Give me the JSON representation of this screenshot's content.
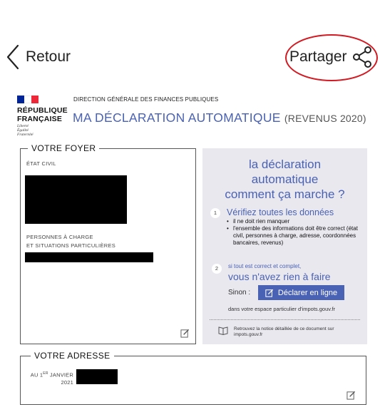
{
  "nav": {
    "back_label": "Retour",
    "share_label": "Partager"
  },
  "header": {
    "republic_line1": "RÉPUBLIQUE",
    "republic_line2": "FRANÇAISE",
    "motto": [
      "Liberté",
      "Égalité",
      "Fraternité"
    ],
    "dgfip": "DIRECTION GÉNÉRALE DES FINANCES PUBLIQUES",
    "title": "MA DÉCLARATION AUTOMATIQUE",
    "subtitle": "(REVENUS 2020)"
  },
  "foyer": {
    "legend": "VOTRE FOYER",
    "etat_civil_label": "ÉTAT CIVIL",
    "charge_label_line1": "PERSONNES À CHARGE",
    "charge_label_line2": "ET SITUATIONS PARTICULIÈRES"
  },
  "help": {
    "title_line1": "la déclaration",
    "title_line2": "automatique",
    "title_line3": "comment ça marche ?",
    "step1_num": "1",
    "step1_title": "Vérifiez toutes les données",
    "step1_bullets": [
      "il ne doit rien manquer",
      "l'ensemble des informations doit être correct (état civil, personnes à charge, adresse, coordonnées bancaires, revenus)"
    ],
    "step2_num": "2",
    "step2_line1": "si tout est correct et complet,",
    "step2_line2": "vous n'avez rien à faire",
    "sinon_label": "Sinon :",
    "declare_button": "Déclarer en ligne",
    "espace_text": "dans votre espace particulier d'impots.gouv.fr",
    "notice_text": "Retrouvez la notice détaillée de ce document sur impots.gouv.fr"
  },
  "adresse": {
    "legend": "VOTRE ADRESSE",
    "au_prefix": "AU 1",
    "au_sup": "ER",
    "au_suffix": " JANVIER",
    "au_year": "2021"
  },
  "colors": {
    "accent": "#4a62b3",
    "highlight_ring": "#d31a22",
    "panel_bg": "#e9e8ef",
    "flag_blue": "#002395",
    "flag_red": "#ed2939"
  }
}
